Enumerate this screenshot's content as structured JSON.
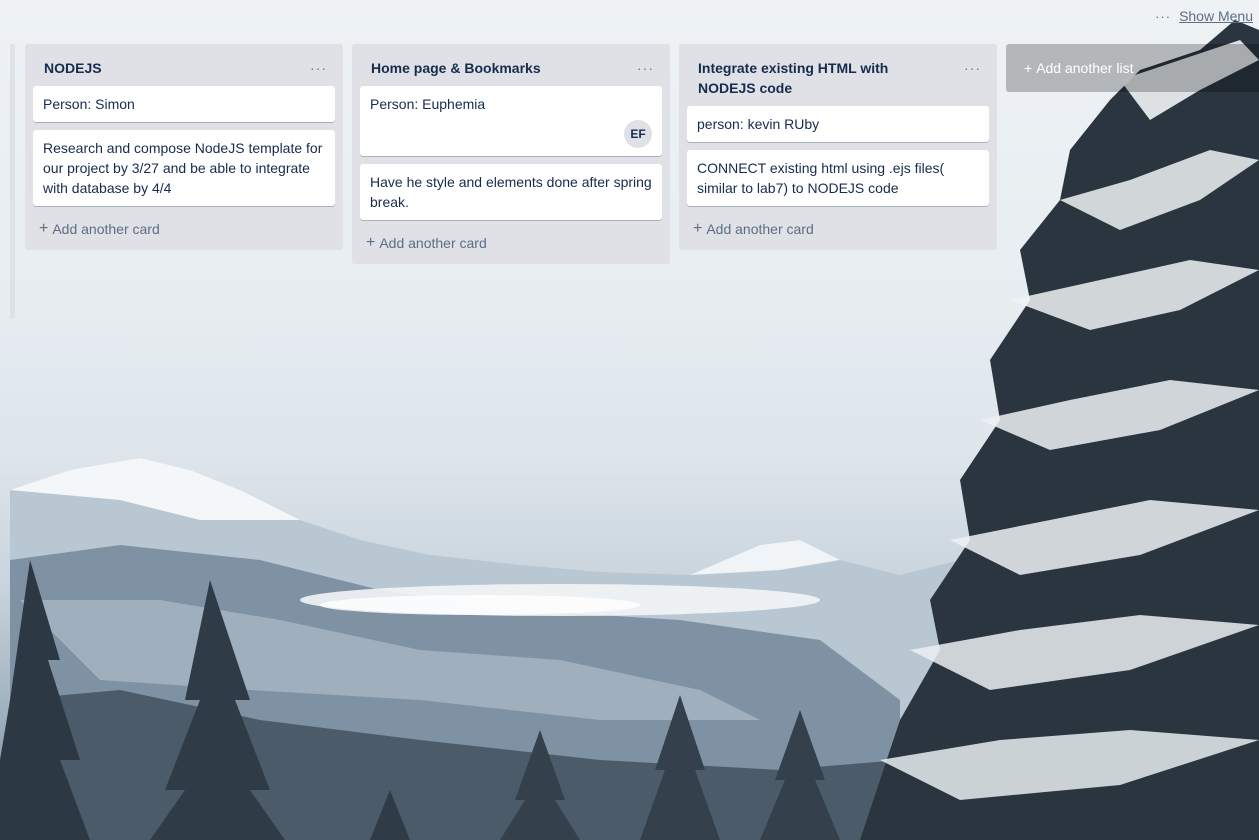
{
  "board": {
    "more_label": "···",
    "show_menu_label": "Show Menu"
  },
  "lists": [
    {
      "title": "NODEJS",
      "more": "···",
      "cards": [
        {
          "text": "Person: Simon"
        },
        {
          "text": "Research and compose NodeJS template for our project by 3/27 and be able to integrate with database by 4/4"
        }
      ],
      "add_card": "Add another card"
    },
    {
      "title": "Home page & Bookmarks",
      "more": "···",
      "cards": [
        {
          "text": "Person: Euphemia",
          "member": "EF"
        },
        {
          "text": "Have he style and elements done after spring break."
        }
      ],
      "add_card": "Add another card"
    },
    {
      "title": "Integrate existing HTML with NODEJS code",
      "more": "···",
      "cards": [
        {
          "text": "person: kevin RUby"
        },
        {
          "text": "CONNECT existing html using .ejs files( similar to lab7) to NODEJS code"
        }
      ],
      "add_card": "Add another card"
    }
  ],
  "add_list_label": "Add another list",
  "plus_glyph": "+"
}
